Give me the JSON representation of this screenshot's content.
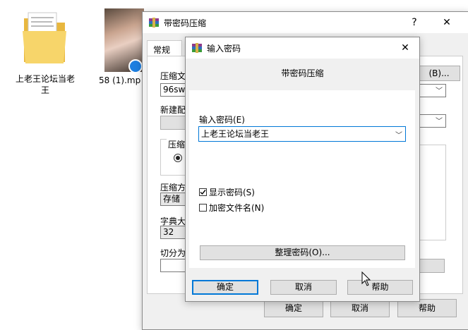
{
  "desktop": {
    "folder_label": "上老王论坛当老王",
    "video_label": "58 (1).mp"
  },
  "back_window": {
    "title": "带密码压缩",
    "help_btn": "?",
    "close_btn": "✕",
    "tab_general": "常规",
    "archive_name_label": "压缩文",
    "archive_name_value": "96swa",
    "browse_btn": "(B)...",
    "profile_label": "新建配",
    "format_group": "压缩",
    "method_label": "压缩方",
    "method_value": "存储",
    "dict_label": "字典大",
    "dict_value": "32",
    "split_label": "切分为",
    "ok_btn": "确定",
    "cancel_btn": "取消",
    "help_button": "帮助"
  },
  "dialog": {
    "title": "输入密码",
    "close_btn": "✕",
    "subtitle": "带密码压缩",
    "password_label": "输入密码(E)",
    "password_value": "上老王论坛当老王",
    "show_password_label": "显示密码(S)",
    "show_password_checked": true,
    "encrypt_names_label": "加密文件名(N)",
    "encrypt_names_checked": false,
    "organize_btn": "整理密码(O)...",
    "ok_btn": "确定",
    "cancel_btn": "取消",
    "help_btn": "帮助"
  }
}
